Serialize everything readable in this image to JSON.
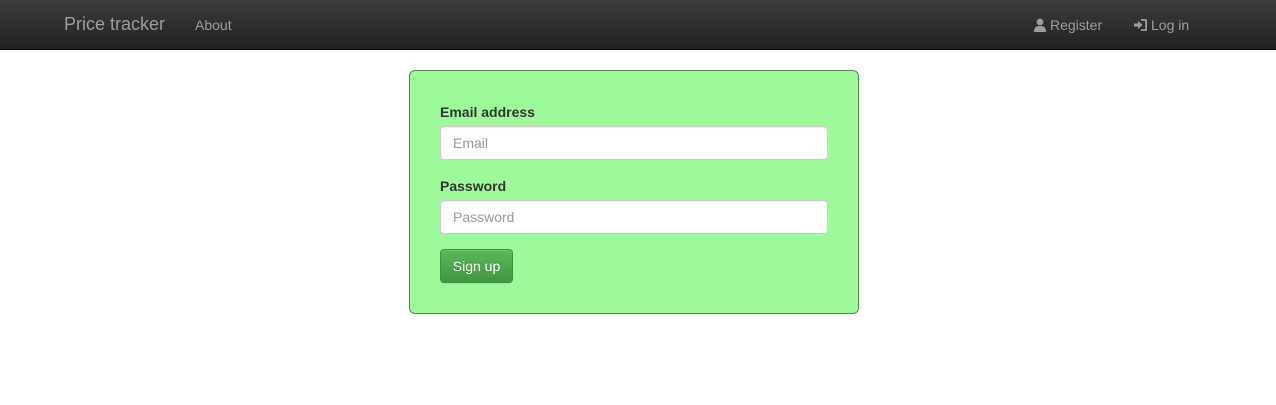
{
  "navbar": {
    "brand": "Price tracker",
    "about": "About",
    "register": "Register",
    "register_icon": "user-icon",
    "login": "Log in",
    "login_icon": "log-in-icon",
    "text_color": "#9d9d9d",
    "background": "#222222"
  },
  "form": {
    "email_label": "Email address",
    "email_placeholder": "Email",
    "email_value": "",
    "password_label": "Password",
    "password_placeholder": "Password",
    "password_value": "",
    "submit_label": "Sign up",
    "panel_color": "#9dfa9b",
    "button_color": "#5cb85c"
  }
}
